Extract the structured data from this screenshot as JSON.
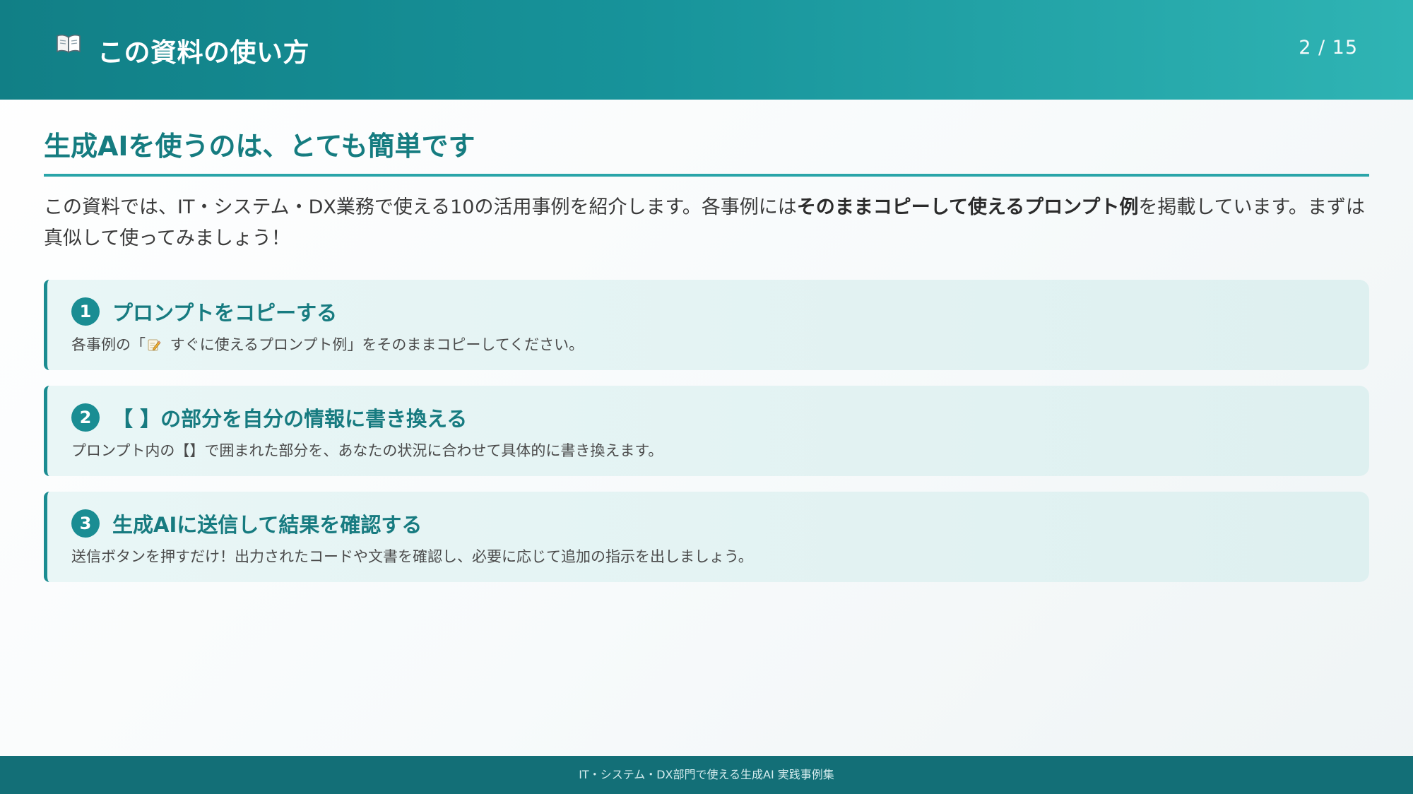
{
  "header": {
    "icon": "open-book-icon",
    "title": "この資料の使い方",
    "page_counter": "2 / 15"
  },
  "section": {
    "title": "生成AIを使うのは、とても簡単です"
  },
  "intro": {
    "text_before": "この資料では、IT・システム・DX業務で使える10の活用事例を紹介します。各事例には",
    "text_bold": "そのままコピーして使えるプロンプト例",
    "text_after": "を掲載しています。まずは真似して使ってみましょう！"
  },
  "steps": [
    {
      "number": "1",
      "title": "プロンプトをコピーする",
      "desc_before": "各事例の「",
      "desc_icon": "memo-icon",
      "desc_after": " すぐに使えるプロンプト例」をそのままコピーしてください。"
    },
    {
      "number": "2",
      "title": "【 】の部分を自分の情報に書き換える",
      "desc": "プロンプト内の【】で囲まれた部分を、あなたの状況に合わせて具体的に書き換えます。"
    },
    {
      "number": "3",
      "title": "生成AIに送信して結果を確認する",
      "desc": "送信ボタンを押すだけ！出力されたコードや文書を確認し、必要に応じて追加の指示を出しましょう。"
    }
  ],
  "footer": {
    "text": "IT・システム・DX部門で使える生成AI 実践事例集"
  },
  "colors": {
    "header_start": "#117f86",
    "header_end": "#2fb4b4",
    "accent": "#1a8d93",
    "heading_text": "#157c80",
    "card_background": "#e4f3f3",
    "footer_background": "#136f77"
  }
}
